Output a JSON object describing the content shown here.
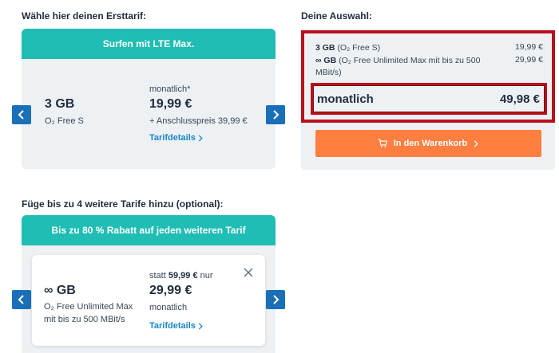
{
  "first_tariff": {
    "heading": "Wähle hier deinen Ersttarif:",
    "banner": "Surfen mit LTE Max.",
    "data_volume": "3 GB",
    "plan_name": "O₂ Free S",
    "billing_label": "monatlich*",
    "price": "19,99 €",
    "setup_fee": "+ Anschlusspreis 39,99 €",
    "details_link": "Tarifdetails"
  },
  "additional_tariffs": {
    "heading": "Füge bis zu 4 weitere Tarife hinzu (optional):",
    "banner": "Bis zu 80 % Rabatt auf jeden weiteren Tarif",
    "data_volume": "∞ GB",
    "plan_name_line1": "O₂ Free Unlimited Max",
    "plan_name_line2": "mit bis zu 500 MBit/s",
    "strike_prefix": "statt",
    "strike_price": "59,99 €",
    "strike_suffix": "nur",
    "price": "29,99 €",
    "billing_label": "monatlich",
    "details_link": "Tarifdetails"
  },
  "selection": {
    "heading": "Deine Auswahl:",
    "items": [
      {
        "volume": "3 GB",
        "name": "(O₂ Free S)",
        "price": "19,99 €"
      },
      {
        "volume": "∞ GB",
        "name": "(O₂ Free Unlimited Max mit bis zu 500",
        "name_line2": "MBit/s)",
        "price": "29,99 €"
      }
    ],
    "total_label": "monatlich",
    "total_price": "49,98 €",
    "cart_button": "In den Warenkorb"
  },
  "colors": {
    "teal": "#1fbdb4",
    "nav_blue": "#1a6fb8",
    "link_blue": "#1787c8",
    "orange": "#ff7e40",
    "highlight_red": "#b7121c"
  },
  "icons": {
    "prev": "chevron-left-icon",
    "next": "chevron-right-icon",
    "cart": "cart-icon",
    "close": "close-icon"
  }
}
